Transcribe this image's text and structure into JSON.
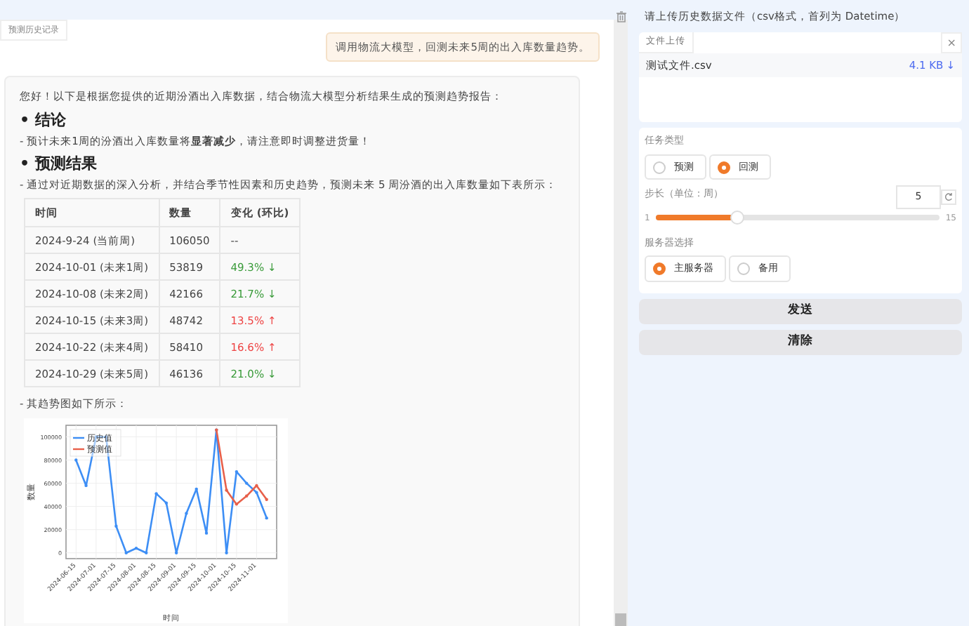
{
  "history_tab": {
    "label": "预测历史记录"
  },
  "user_message": "调用物流大模型，回测未来5周的出入库数量趋势。",
  "reply": {
    "intro": "您好！以下是根据您提供的近期汾酒出入库数据，结合物流大模型分析结果生成的预测趋势报告：",
    "conclusion_heading": "• 结论",
    "conclusion_text": "- 预计未来1周的汾酒出入库数量将**显著减少**，请注意即时调整进货量！",
    "results_heading": "• 预测结果",
    "results_text": "- 通过对近期数据的深入分析，并结合季节性因素和历史趋势，预测未来 5 周汾酒的出入库数量如下表所示：",
    "table": {
      "columns": [
        "时间",
        "数量",
        "变化 (环比)"
      ],
      "rows": [
        {
          "time": "2024-9-24 (当前周)",
          "quantity": "106050",
          "change": "--"
        },
        {
          "time": "2024-10-01 (未来1周)",
          "quantity": "53819",
          "change": "49.3% ↓",
          "color": "#3a9b3a"
        },
        {
          "time": "2024-10-08 (未来2周)",
          "quantity": "42166",
          "change": "21.7% ↓",
          "color": "#3a9b3a"
        },
        {
          "time": "2024-10-15 (未来3周)",
          "quantity": "48742",
          "change": "13.5% ↑",
          "color": "#ee4444"
        },
        {
          "time": "2024-10-22 (未来4周)",
          "quantity": "58410",
          "change": "16.6% ↑",
          "color": "#ee4444"
        },
        {
          "time": "2024-10-29 (未来5周)",
          "quantity": "46136",
          "change": "21.0% ↓",
          "color": "#3a9b3a"
        }
      ]
    },
    "chart_intro": "- 其趋势图如下所示：",
    "chart_data": {
      "type": "line",
      "grid": true,
      "legend": "upper left",
      "xlabel": "时间",
      "ylabel": "数量",
      "categories": [
        "2024-06-15",
        null,
        "2024-07-01",
        null,
        "2024-07-15",
        null,
        "2024-08-01",
        null,
        "2024-08-15",
        null,
        "2024-09-01",
        null,
        "2024-09-15",
        null,
        "2024-10-01",
        null,
        "2024-10-15",
        null,
        "2024-11-01",
        null
      ],
      "ylim": [
        -5000,
        110000
      ],
      "yticks": [
        0,
        20000,
        40000,
        60000,
        80000,
        100000
      ],
      "series": [
        {
          "name": "历史值",
          "color": "#3d8ef5",
          "values": [
            80000,
            58000,
            100000,
            100000,
            23000,
            0,
            4000,
            0,
            51000,
            43000,
            0,
            34000,
            55000,
            17000,
            106000,
            0,
            70000,
            60000,
            52000,
            30000
          ]
        },
        {
          "name": "预测值",
          "color": "#e8604a",
          "values": [
            null,
            null,
            null,
            null,
            null,
            null,
            null,
            null,
            null,
            null,
            null,
            null,
            null,
            null,
            106000,
            54000,
            42000,
            49000,
            58000,
            46000
          ]
        }
      ]
    }
  },
  "upload": {
    "label": "请上传历史数据文件（csv格式，首列为 Datetime）",
    "tab": "文件上传",
    "close": "×",
    "file_name": "测试文件.csv",
    "file_size": "4.1 KB",
    "download": "↓"
  },
  "task_type": {
    "label": "任务类型",
    "options": [
      {
        "label": "预测",
        "selected": false
      },
      {
        "label": "回测",
        "selected": true
      }
    ]
  },
  "step": {
    "label": "步长（单位：周）",
    "value": "5",
    "min": "1",
    "max": "15",
    "level": 0.286
  },
  "server": {
    "label": "服务器选择",
    "options": [
      {
        "label": "主服务器",
        "selected": true
      },
      {
        "label": "备用",
        "selected": false
      }
    ]
  },
  "buttons": [
    "发送",
    "清除"
  ]
}
